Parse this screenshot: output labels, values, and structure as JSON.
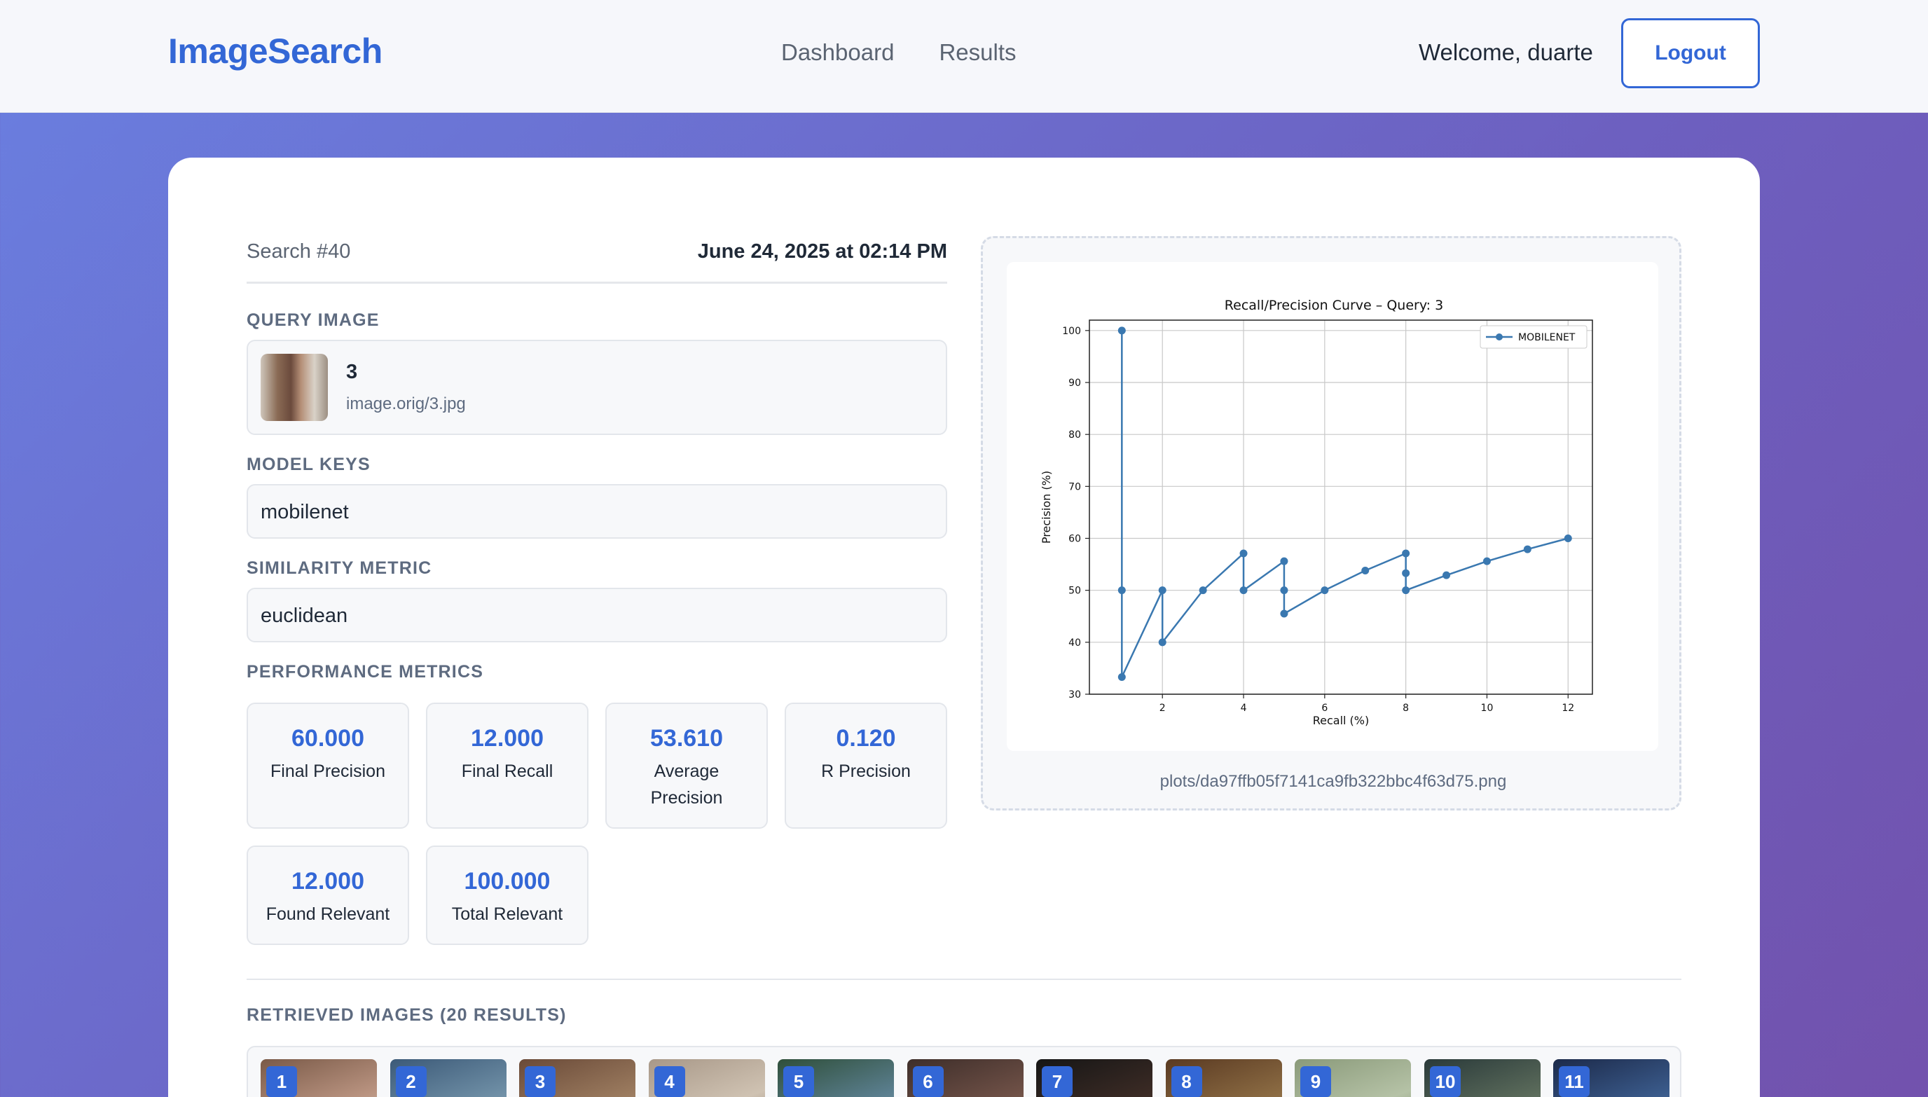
{
  "nav": {
    "brand": "ImageSearch",
    "links": [
      "Dashboard",
      "Results"
    ],
    "welcome": "Welcome, duarte",
    "logout": "Logout"
  },
  "search": {
    "id": "Search #40",
    "date": "June 24, 2025 at 02:14 PM"
  },
  "query": {
    "label": "QUERY IMAGE",
    "name": "3",
    "path": "image.orig/3.jpg"
  },
  "model": {
    "label": "MODEL KEYS",
    "value": "mobilenet"
  },
  "similarity": {
    "label": "SIMILARITY METRIC",
    "value": "euclidean"
  },
  "performance": {
    "label": "PERFORMANCE METRICS",
    "metrics": [
      {
        "value": "60.000",
        "label": "Final Precision"
      },
      {
        "value": "12.000",
        "label": "Final Recall"
      },
      {
        "value": "53.610",
        "label": "Average Precision"
      },
      {
        "value": "0.120",
        "label": "R Precision"
      },
      {
        "value": "12.000",
        "label": "Found Relevant"
      },
      {
        "value": "100.000",
        "label": "Total Relevant"
      }
    ]
  },
  "plot": {
    "path": "plots/da97ffb05f7141ca9fb322bbc4f63d75.png"
  },
  "results": {
    "label": "RETRIEVED IMAGES (20 RESULTS)",
    "visible_badges": [
      "1",
      "2",
      "3",
      "4",
      "5",
      "6",
      "7",
      "8",
      "9",
      "10",
      "11"
    ]
  },
  "colors": {
    "accent": "#3367d6",
    "series": "#3a78b0"
  },
  "chart_data": {
    "type": "line",
    "title": "Recall/Precision Curve – Query: 3",
    "xlabel": "Recall (%)",
    "ylabel": "Precision (%)",
    "xlim": [
      0.2,
      12.6
    ],
    "ylim": [
      30,
      102
    ],
    "xticks": [
      2,
      4,
      6,
      8,
      10,
      12
    ],
    "yticks": [
      30,
      40,
      50,
      60,
      70,
      80,
      90,
      100
    ],
    "grid": true,
    "legend": "top-right",
    "series": [
      {
        "name": "MOBILENET",
        "x": [
          1,
          1,
          1,
          2,
          2,
          3,
          4,
          4,
          5,
          5,
          5,
          6,
          7,
          8,
          8,
          8,
          9,
          10,
          11,
          12
        ],
        "y": [
          100,
          50,
          33.3,
          50,
          40,
          50,
          57.1,
          50,
          55.6,
          50,
          45.5,
          50,
          53.8,
          57.1,
          53.3,
          50,
          52.9,
          55.6,
          57.9,
          60
        ]
      }
    ]
  }
}
